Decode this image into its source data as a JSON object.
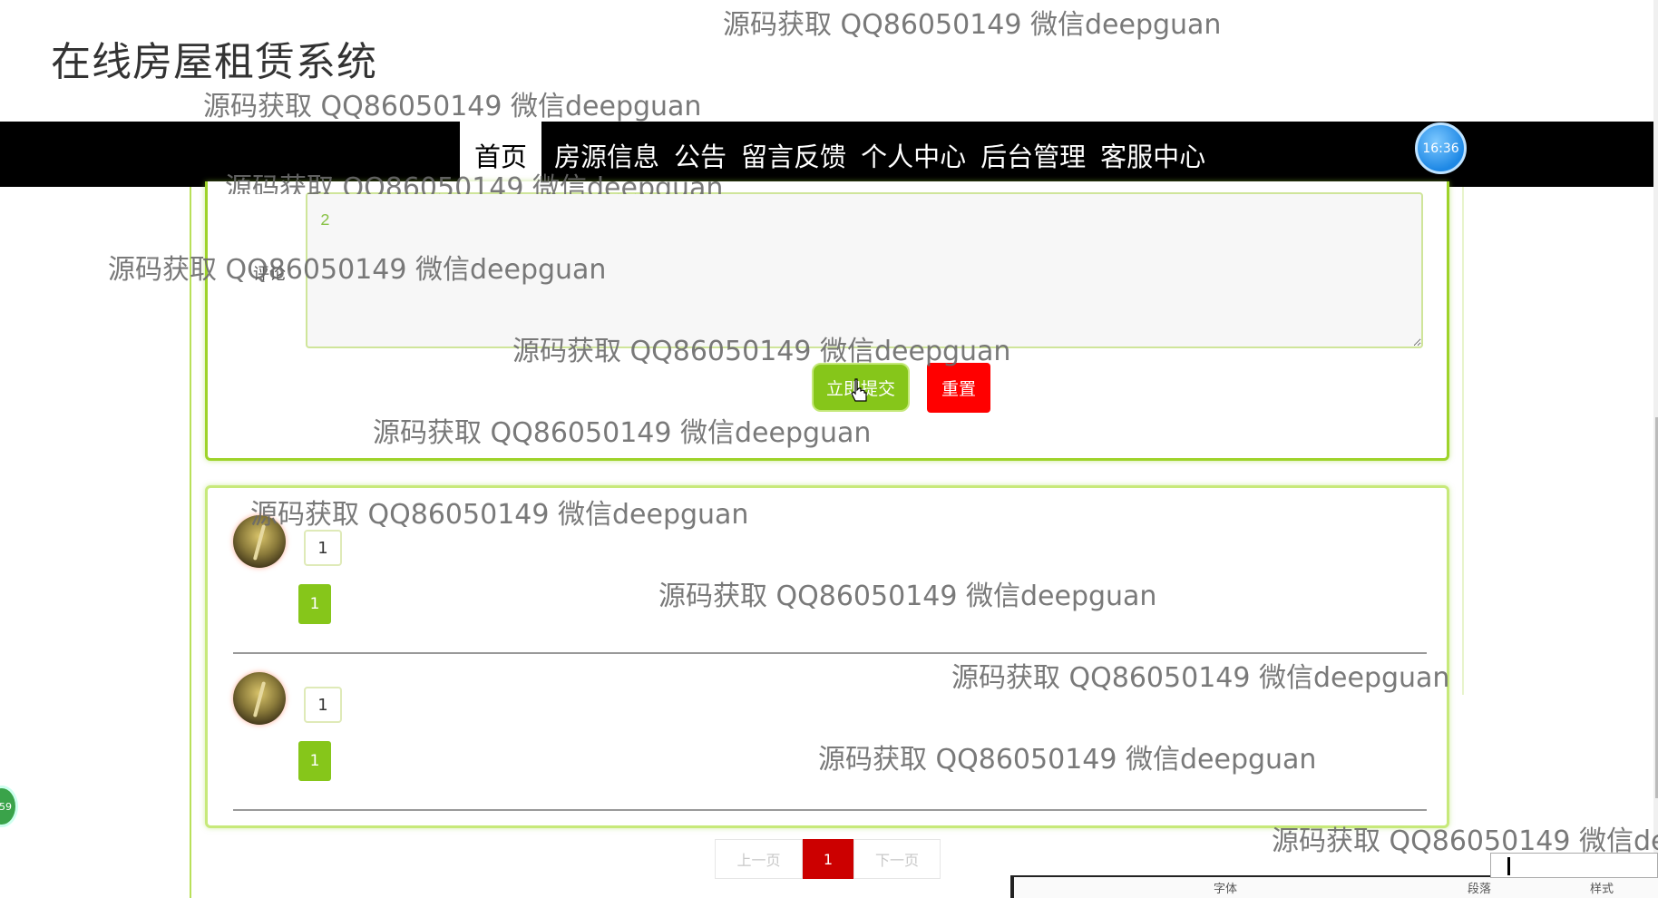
{
  "site": {
    "title": "在线房屋租赁系统"
  },
  "nav": {
    "items": [
      {
        "label": "首页",
        "active": true
      },
      {
        "label": "房源信息"
      },
      {
        "label": "公告"
      },
      {
        "label": "留言反馈"
      },
      {
        "label": "个人中心"
      },
      {
        "label": "后台管理"
      },
      {
        "label": "客服中心"
      }
    ],
    "clock": "16:36"
  },
  "form": {
    "comment_label": "评论",
    "comment_value": "2",
    "submit_label": "立即提交",
    "reset_label": "重置"
  },
  "comments": [
    {
      "name": "1",
      "content": "1"
    },
    {
      "name": "1",
      "content": "1"
    }
  ],
  "pager": {
    "prev": "上一页",
    "current": "1",
    "next": "下一页"
  },
  "side_bubble": "59",
  "watermark": "源码获取 QQ86050149 微信deepguan",
  "watermark_cut": "源码获取 QQ86050149 微信de",
  "taskbar": {
    "labels": [
      "字体",
      "段落",
      "样式"
    ]
  },
  "colors": {
    "accent": "#86c61a",
    "danger": "#ff0000",
    "pager_active": "#cc0000",
    "nav_bg": "#000000"
  }
}
